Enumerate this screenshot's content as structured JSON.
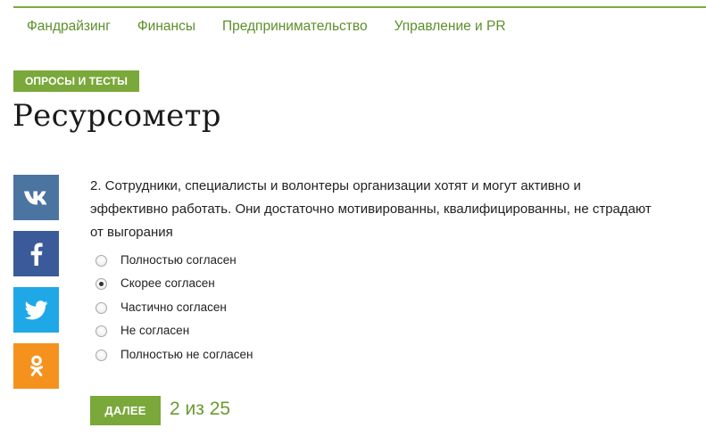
{
  "nav": {
    "items": [
      "Фандрайзинг",
      "Финансы",
      "Предпринимательство",
      "Управление и PR"
    ]
  },
  "article": {
    "category": "ОПРОСЫ И ТЕСТЫ",
    "title": "Ресурсометр"
  },
  "social": {
    "icons": [
      "vk-icon",
      "facebook-icon",
      "twitter-icon",
      "odnoklassniki-icon"
    ],
    "colors": {
      "vk": "#4c74a0",
      "facebook": "#3b5a99",
      "twitter": "#1fa8e8",
      "odnoklassniki": "#f5921e"
    }
  },
  "quiz": {
    "question": "2.  Сотрудники, специалисты и волонтеры организации хотят и могут активно и эффективно работать. Они достаточно мотивированны, квалифицированны, не страдают от выгорания",
    "options": [
      "Полностью согласен",
      "Скорее согласен",
      "Частично согласен",
      "Не согласен",
      "Полностью не согласен"
    ],
    "selected": "Скорее согласен",
    "next_label": "ДАЛЕЕ",
    "progress": "2 из 25"
  },
  "colors": {
    "accent": "#7aa83a",
    "link": "#5d8f2a"
  }
}
